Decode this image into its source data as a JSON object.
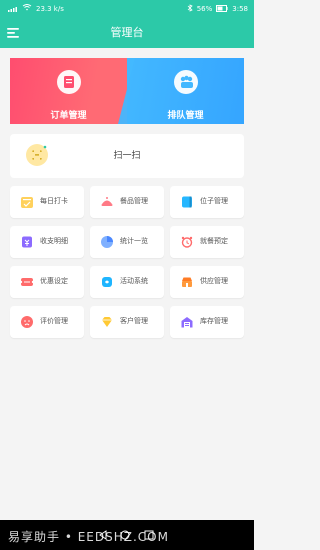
{
  "status": {
    "left": "23.3 k/s",
    "battery": "56%",
    "time": "3:58"
  },
  "header": {
    "title": "管理台"
  },
  "banner": {
    "left_label": "订单管理",
    "right_label": "排队管理"
  },
  "scan": {
    "label": "扫一扫"
  },
  "grid": {
    "items": [
      {
        "label": "每日打卡"
      },
      {
        "label": "餐品管理"
      },
      {
        "label": "位子管理"
      },
      {
        "label": "收支明细"
      },
      {
        "label": "统计一览"
      },
      {
        "label": "就餐预定"
      },
      {
        "label": "优惠设定"
      },
      {
        "label": "活动系统"
      },
      {
        "label": "供应管理"
      },
      {
        "label": "评价管理"
      },
      {
        "label": "客户管理"
      },
      {
        "label": "库存管理"
      }
    ]
  },
  "watermark": "易享助手 • EEDSHZ.COM",
  "colors": {
    "header": "#2cc9a8",
    "banner_left": "#ff4d6f",
    "banner_right": "#43b8ff"
  }
}
